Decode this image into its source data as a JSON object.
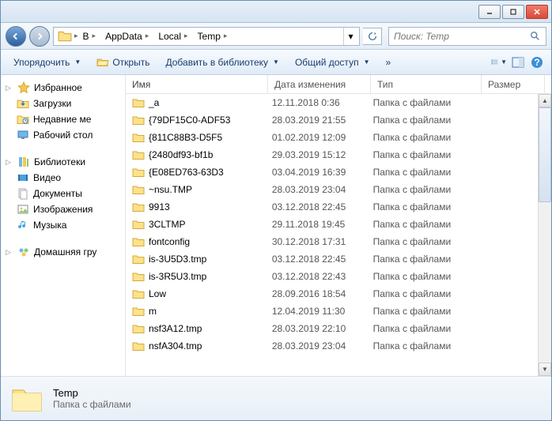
{
  "titlebar": {
    "min": "_",
    "max": "☐",
    "close": "✕"
  },
  "nav": {
    "breadcrumb": [
      "B",
      "AppData",
      "Local",
      "Temp"
    ],
    "search_placeholder": "Поиск: Temp"
  },
  "toolbar": {
    "organize": "Упорядочить",
    "open": "Открыть",
    "add_library": "Добавить в библиотеку",
    "share": "Общий доступ",
    "burn": "»"
  },
  "sidebar": {
    "favorites": {
      "label": "Избранное",
      "items": [
        {
          "label": "Загрузки",
          "icon": "downloads"
        },
        {
          "label": "Недавние ме",
          "icon": "recent"
        },
        {
          "label": "Рабочий стол",
          "icon": "desktop"
        }
      ]
    },
    "libraries": {
      "label": "Библиотеки",
      "items": [
        {
          "label": "Видео",
          "icon": "video"
        },
        {
          "label": "Документы",
          "icon": "docs"
        },
        {
          "label": "Изображения",
          "icon": "pics"
        },
        {
          "label": "Музыка",
          "icon": "music"
        }
      ]
    },
    "homegroup": {
      "label": "Домашняя гру",
      "icon": "homegroup"
    }
  },
  "columns": {
    "name": "Имя",
    "date": "Дата изменения",
    "type": "Тип",
    "size": "Размер"
  },
  "type_folder": "Папка с файлами",
  "files": [
    {
      "name": "_a",
      "date": "12.11.2018 0:36"
    },
    {
      "name": "{79DF15C0-ADF53",
      "date": "28.03.2019 21:55"
    },
    {
      "name": "{811C88B3-D5F5",
      "date": "01.02.2019 12:09"
    },
    {
      "name": "{2480df93-bf1b",
      "date": "29.03.2019 15:12"
    },
    {
      "name": "{E08ED763-63D3",
      "date": "03.04.2019 16:39"
    },
    {
      "name": "~nsu.TMP",
      "date": "28.03.2019 23:04"
    },
    {
      "name": "9913",
      "date": "03.12.2018 22:45"
    },
    {
      "name": "3CLTMP",
      "date": "29.11.2018 19:45"
    },
    {
      "name": "fontconfig",
      "date": "30.12.2018 17:31"
    },
    {
      "name": "is-3U5D3.tmp",
      "date": "03.12.2018 22:45"
    },
    {
      "name": "is-3R5U3.tmp",
      "date": "03.12.2018 22:43"
    },
    {
      "name": "Low",
      "date": "28.09.2016 18:54"
    },
    {
      "name": "m",
      "date": "12.04.2019 11:30"
    },
    {
      "name": "nsf3A12.tmp",
      "date": "28.03.2019 22:10"
    },
    {
      "name": "nsfA304.tmp",
      "date": "28.03.2019 23:04"
    }
  ],
  "details": {
    "name": "Temp",
    "type": "Папка с файлами"
  }
}
